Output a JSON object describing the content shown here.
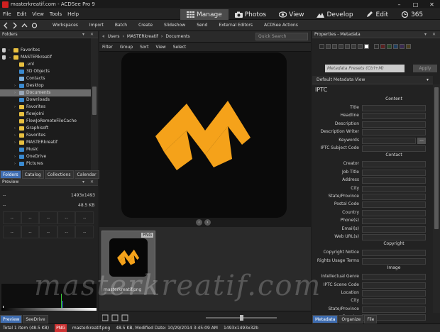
{
  "window": {
    "title": "masterkreatif.com - ACDSee Pro 9",
    "controls": [
      "–",
      "□",
      "✕"
    ]
  },
  "menu": [
    "File",
    "Edit",
    "View",
    "Tools",
    "Help"
  ],
  "modes": [
    {
      "label": "Manage",
      "icon": "grid-icon",
      "active": true
    },
    {
      "label": "Photos",
      "icon": "camera-icon",
      "active": false
    },
    {
      "label": "View",
      "icon": "eye-icon",
      "active": false
    },
    {
      "label": "Develop",
      "icon": "develop-icon",
      "active": false
    },
    {
      "label": "Edit",
      "icon": "edit-icon",
      "active": false
    },
    {
      "label": "365",
      "icon": "365-icon",
      "active": false
    }
  ],
  "toolbar": [
    "Workspaces",
    "Import",
    "Batch",
    "Create",
    "Slideshow",
    "Send",
    "External Editors",
    "ACDSee Actions"
  ],
  "folders": {
    "title": "Folders",
    "rows": [
      {
        "label": "Favorites",
        "depth": 0,
        "color": "#e8c040",
        "arrow": "›",
        "sel": false
      },
      {
        "label": "MASTERkreatif",
        "depth": 0,
        "color": "#e8c040",
        "arrow": "⌄",
        "sel": false
      },
      {
        "label": ".vnl",
        "depth": 1,
        "color": "#e8c040",
        "arrow": "",
        "sel": false
      },
      {
        "label": "3D Objects",
        "depth": 1,
        "color": "#3a8ad0",
        "arrow": "",
        "sel": false
      },
      {
        "label": "Contacts",
        "depth": 1,
        "color": "#7ab0e0",
        "arrow": "",
        "sel": false
      },
      {
        "label": "Desktop",
        "depth": 1,
        "color": "#3a8ad0",
        "arrow": "›",
        "sel": false
      },
      {
        "label": "Documents",
        "depth": 1,
        "color": "#9aa8b8",
        "arrow": "›",
        "sel": true
      },
      {
        "label": "Downloads",
        "depth": 1,
        "color": "#3a8ad0",
        "arrow": "",
        "sel": false
      },
      {
        "label": "Favorites",
        "depth": 1,
        "color": "#e8c040",
        "arrow": "›",
        "sel": false
      },
      {
        "label": "flowjoIni",
        "depth": 1,
        "color": "#e8c040",
        "arrow": "",
        "sel": false
      },
      {
        "label": "FlowJoRemoteFileCache",
        "depth": 1,
        "color": "#e8c040",
        "arrow": "",
        "sel": false
      },
      {
        "label": "Graphisoft",
        "depth": 1,
        "color": "#e8c040",
        "arrow": "›",
        "sel": false
      },
      {
        "label": "Favorites",
        "depth": 1,
        "color": "#e8c040",
        "arrow": "›",
        "sel": false
      },
      {
        "label": "MASTERkreatif",
        "depth": 1,
        "color": "#e8c040",
        "arrow": "›",
        "sel": false
      },
      {
        "label": "Music",
        "depth": 1,
        "color": "#3a8ad0",
        "arrow": "",
        "sel": false
      },
      {
        "label": "OneDrive",
        "depth": 1,
        "color": "#3a8ad0",
        "arrow": "›",
        "sel": false
      },
      {
        "label": "Pictures",
        "depth": 1,
        "color": "#3a8ad0",
        "arrow": "›",
        "sel": false
      }
    ],
    "tabs": [
      {
        "label": "Folders",
        "active": true
      },
      {
        "label": "Catalog",
        "active": false
      },
      {
        "label": "Collections",
        "active": false
      },
      {
        "label": "Calendar",
        "active": false
      }
    ]
  },
  "preview": {
    "title": "Preview",
    "dims_top": "1493x1493",
    "size": "48.5 KB",
    "dash": "--",
    "grid1": [
      "--",
      "--",
      "--",
      "--",
      "--"
    ],
    "grid2": [
      "--",
      "--",
      "--",
      "--",
      "--"
    ],
    "tabs": [
      {
        "label": "Preview",
        "active": true
      },
      {
        "label": "SeeDrive",
        "active": false
      }
    ]
  },
  "pathbar": {
    "crumbs": [
      "«",
      "Users",
      "›",
      "MASTERkreatif",
      "›",
      "Documents"
    ],
    "search_placeholder": "Quick Search"
  },
  "filterbar": [
    "Filter",
    "Group",
    "Sort",
    "View",
    "Select"
  ],
  "thumb": {
    "badge": "PNG",
    "filename": "masterkreatif.png"
  },
  "rightpanel": {
    "title": "Properties - Metadata",
    "swatch_colors": [
      "#2a2a2a",
      "#3a3a3a",
      "#3a3a3a",
      "#3a3a3a",
      "#3a3a3a",
      "#3a3a3a",
      "#3a3a3a",
      "#ffffff",
      "#2a2a2a",
      "#5a2020",
      "#2a4a2a",
      "#204060",
      "#3a2a50",
      "#4a4020"
    ],
    "preset_placeholder": "Metadata Presets (Ctrl+M)",
    "apply": "Apply",
    "view": "Default Metadata View",
    "iptc": "IPTC",
    "sections": [
      {
        "type": "section",
        "label": "Content"
      },
      {
        "type": "field",
        "label": "Title"
      },
      {
        "type": "field",
        "label": "Headline"
      },
      {
        "type": "field",
        "label": "Description"
      },
      {
        "type": "field",
        "label": "Description Writer"
      },
      {
        "type": "field",
        "label": "Keywords",
        "btn": "..."
      },
      {
        "type": "field",
        "label": "IPTC Subject Code"
      },
      {
        "type": "section",
        "label": "Contact"
      },
      {
        "type": "field",
        "label": "Creator"
      },
      {
        "type": "field",
        "label": "Job Title"
      },
      {
        "type": "field",
        "label": "Address"
      },
      {
        "type": "field",
        "label": "City"
      },
      {
        "type": "field",
        "label": "State/Province"
      },
      {
        "type": "field",
        "label": "Postal Code"
      },
      {
        "type": "field",
        "label": "Country"
      },
      {
        "type": "field",
        "label": "Phone(s)"
      },
      {
        "type": "field",
        "label": "Email(s)"
      },
      {
        "type": "field",
        "label": "Web URL(s)"
      },
      {
        "type": "section",
        "label": "Copyright"
      },
      {
        "type": "field",
        "label": "Copyright Notice"
      },
      {
        "type": "field",
        "label": "Rights Usage Terms"
      },
      {
        "type": "section",
        "label": "Image"
      },
      {
        "type": "field",
        "label": "Intellectual Genre"
      },
      {
        "type": "field",
        "label": "IPTC Scene Code"
      },
      {
        "type": "field",
        "label": "Location"
      },
      {
        "type": "field",
        "label": "City"
      },
      {
        "type": "field",
        "label": "State/Province"
      },
      {
        "type": "field",
        "label": "Country"
      }
    ],
    "tabs": [
      {
        "label": "Metadata",
        "active": true
      },
      {
        "label": "Organize",
        "active": false
      },
      {
        "label": "File",
        "active": false
      }
    ]
  },
  "status": {
    "total": "Total 1 item (48.5 KB)",
    "type": "PNG",
    "file": "masterkreatif.png",
    "details": "48.5 KB, Modified Date: 10/29/2014 3:45:09 AM",
    "dims": "1493x1493x32b"
  },
  "watermark": "masterkreatif.com",
  "accent": "#f5a21a"
}
